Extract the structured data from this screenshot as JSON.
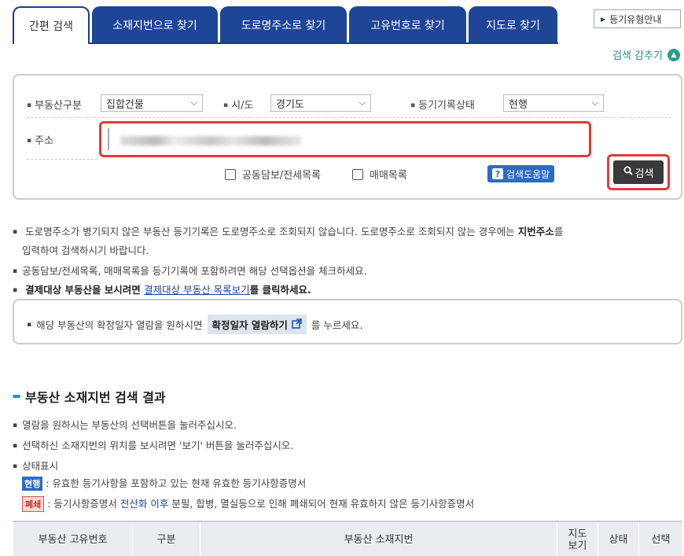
{
  "tabs": [
    "간편 검색",
    "소재지번으로 찾기",
    "도로명주소로 찾기",
    "고유번호로 찾기",
    "지도로 찾기"
  ],
  "guide_button": "등기유형안내",
  "collapse_label": "검색 감추기",
  "form": {
    "property_type_label": "부동산구분",
    "property_type_value": "집합건물",
    "region_label": "시/도",
    "region_value": "경기도",
    "status_label": "등기기록상태",
    "status_value": "현행",
    "address_label": "주소",
    "joint_security_label": "공동담보/전세목록",
    "sale_list_label": "매매목록",
    "help_label": "검색도움말",
    "search_label": "검색"
  },
  "notes": {
    "n1a": "도로명주소가 병기되지 않은 부동산 등기기록은 도로명주소로 조회되지 않습니다. 도로명주소로 조회되지 않는 경우에는 ",
    "n1b": "지번주소",
    "n1c": "를",
    "n1d": "입력하여 검색하시기 바랍니다.",
    "n2": "공동담보/전세목록, 매매목록을 등기기록에 포함하려면 해당 선택옵션을 체크하세요.",
    "n3a": "결제대상 부동산을 보시려면 ",
    "n3b": "결제대상 부동산 목록보기",
    "n3c": "를 클릭하세요."
  },
  "confirm": {
    "before": "해당 부동산의 확정일자 열람을 원하시면",
    "button": "확정일자 열람하기",
    "after": "를 누르세요."
  },
  "results": {
    "title": "부동산 소재지번 검색 결과",
    "info1": "열람을 원하시는 부동산의 선택버튼을 눌러주십시오.",
    "info2": "선택하신 소재지번의 위치를 보시려면 '보기' 버튼을 눌러주십시오.",
    "info3": "상태표시",
    "badge_current": "현행",
    "legend_current": ": 유효한 등기사항을 포함하고 있는 현재 유효한 등기사항증명서",
    "badge_closed": "폐쇄",
    "legend_closed_a": ": 등기사항증명서 ",
    "legend_closed_b": "전산화 이후",
    "legend_closed_c": " 분필, 합병, 멸실등으로 인해 폐쇄되어 현재 유효하지 않은 등기사항증명서"
  },
  "table_headers": [
    "부동산 고유번호",
    "구분",
    "부동산 소재지번",
    "지도\n보기",
    "상태",
    "선택"
  ]
}
